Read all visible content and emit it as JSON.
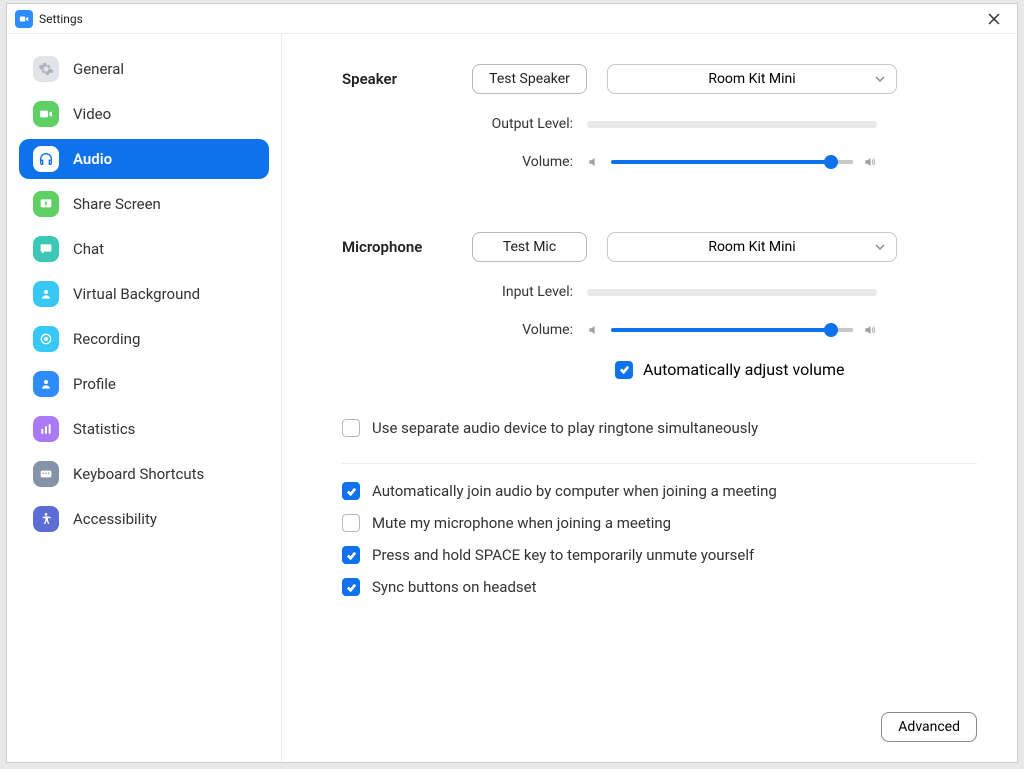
{
  "title": "Settings",
  "nav": {
    "general": "General",
    "video": "Video",
    "audio": "Audio",
    "share": "Share Screen",
    "chat": "Chat",
    "vbg": "Virtual Background",
    "rec": "Recording",
    "profile": "Profile",
    "stats": "Statistics",
    "kbd": "Keyboard Shortcuts",
    "acc": "Accessibility"
  },
  "audio": {
    "speaker_label": "Speaker",
    "test_speaker": "Test Speaker",
    "speaker_device": "Room Kit Mini",
    "output_level": "Output Level:",
    "volume": "Volume:",
    "speaker_vol_pct": 90,
    "mic_label": "Microphone",
    "test_mic": "Test Mic",
    "mic_device": "Room Kit Mini",
    "input_level": "Input Level:",
    "mic_vol_pct": 90,
    "auto_adjust": "Automatically adjust volume",
    "auto_adjust_checked": true,
    "opts": {
      "separate_device": {
        "label": "Use separate audio device to play ringtone simultaneously",
        "checked": false
      },
      "auto_join": {
        "label": "Automatically join audio by computer when joining a meeting",
        "checked": true
      },
      "mute_on_join": {
        "label": "Mute my microphone when joining a meeting",
        "checked": false
      },
      "space_unmute": {
        "label": "Press and hold SPACE key to temporarily unmute yourself",
        "checked": true
      },
      "sync_headset": {
        "label": "Sync buttons on headset",
        "checked": true
      }
    },
    "advanced": "Advanced"
  }
}
